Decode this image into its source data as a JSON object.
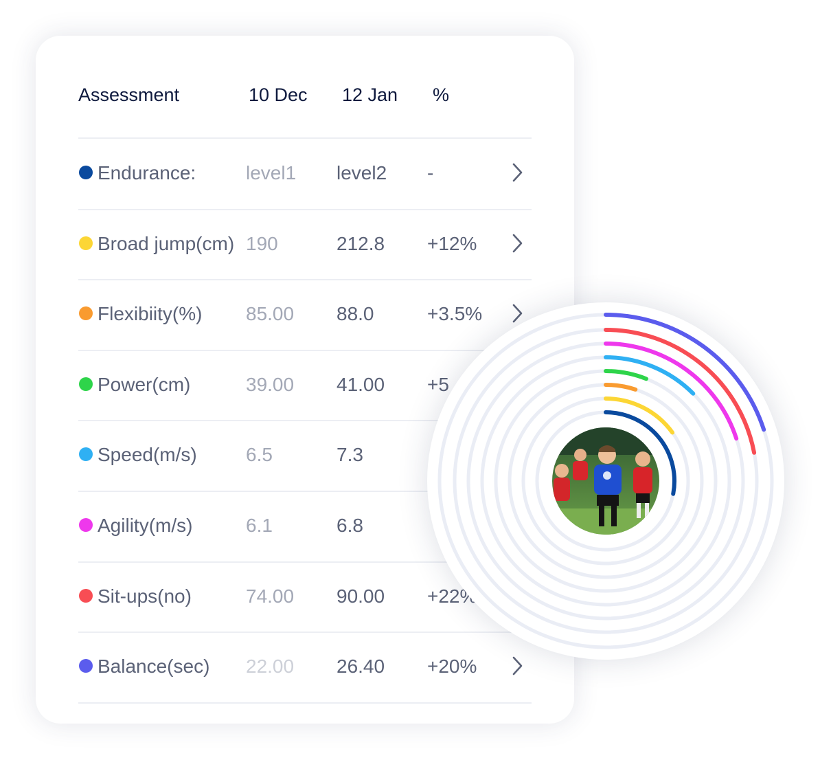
{
  "table": {
    "headers": {
      "assessment": "Assessment",
      "date1": "10 Dec",
      "date2": "12 Jan",
      "percent": "%"
    },
    "rows": [
      {
        "name": "Endurance:",
        "v1": "level1",
        "v2": "level2",
        "pct": "-",
        "color": "#0a4a9e",
        "v1_color": "#a3a8b6",
        "has_chevron": true
      },
      {
        "name": "Broad jump(cm)",
        "v1": "190",
        "v2": "212.8",
        "pct": "+12%",
        "color": "#fcd635",
        "v1_color": "#a3a8b6",
        "has_chevron": true
      },
      {
        "name": "Flexibiity(%)",
        "v1": "85.00",
        "v2": "88.0",
        "pct": "+3.5%",
        "color": "#f99b30",
        "v1_color": "#a3a8b6",
        "has_chevron": true
      },
      {
        "name": "Power(cm)",
        "v1": "39.00",
        "v2": "41.00",
        "pct": "+5",
        "color": "#2ed44a",
        "v1_color": "#a3a8b6",
        "has_chevron": false
      },
      {
        "name": "Speed(m/s)",
        "v1": "6.5",
        "v2": "7.3",
        "pct": "",
        "color": "#2fb0f3",
        "v1_color": "#a3a8b6",
        "has_chevron": false
      },
      {
        "name": "Agility(m/s)",
        "v1": "6.1",
        "v2": "6.8",
        "pct": "",
        "color": "#ee38ec",
        "v1_color": "#a3a8b6",
        "has_chevron": false
      },
      {
        "name": "Sit-ups(no)",
        "v1": "74.00",
        "v2": "90.00",
        "pct": "+22%",
        "color": "#f84d54",
        "v1_color": "#a3a8b6",
        "has_chevron": false
      },
      {
        "name": "Balance(sec)",
        "v1": "22.00",
        "v2": "26.40",
        "pct": "+20%",
        "color": "#5b5ced",
        "v1_color": "#cdd0d8",
        "has_chevron": true
      }
    ]
  },
  "rings": {
    "track_color": "#eaedf5",
    "items": [
      {
        "metric": "Endurance:",
        "progress": 0.28,
        "color": "#0a4a9e"
      },
      {
        "metric": "Broad jump(cm)",
        "progress": 0.15,
        "color": "#fcd635"
      },
      {
        "metric": "Flexibiity(%)",
        "progress": 0.05,
        "color": "#f99b30"
      },
      {
        "metric": "Power(cm)",
        "progress": 0.06,
        "color": "#2ed44a"
      },
      {
        "metric": "Speed(m/s)",
        "progress": 0.125,
        "color": "#2fb0f3"
      },
      {
        "metric": "Agility(m/s)",
        "progress": 0.2,
        "color": "#ee38ec"
      },
      {
        "metric": "Sit-ups(no)",
        "progress": 0.22,
        "color": "#f84d54"
      },
      {
        "metric": "Balance(sec)",
        "progress": 0.2,
        "color": "#5b5ced"
      }
    ]
  },
  "avatar": {
    "subject": "children playing soccer"
  }
}
